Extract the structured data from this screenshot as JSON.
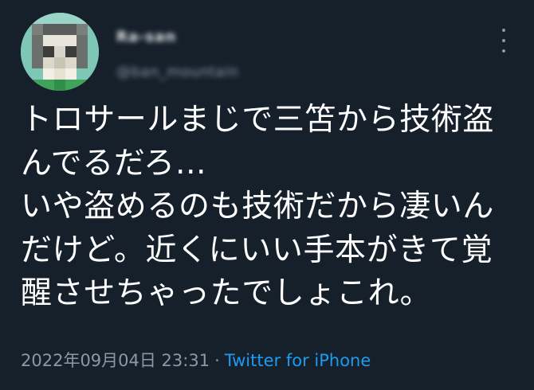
{
  "user": {
    "display_name": "Ra-san",
    "handle": "@ban_mountain"
  },
  "tweet": {
    "lines": [
      "トロサールまじで三笘から技術盗",
      "んでるだろ…",
      "いや盗めるのも技術だから凄いん",
      "だけど。近くにいい手本がきて覚",
      "醒させちゃったでしょこれ。"
    ],
    "timestamp": "2022年09月04日 23:31",
    "separator": "·",
    "source": "Twitter for iPhone"
  },
  "colors": {
    "background": "#15202b",
    "text": "#ffffff",
    "muted": "#8b98a5",
    "link": "#1d9bf0"
  },
  "icons": {
    "more": "more-vertical-icon",
    "avatar": "pixelated-avatar"
  }
}
